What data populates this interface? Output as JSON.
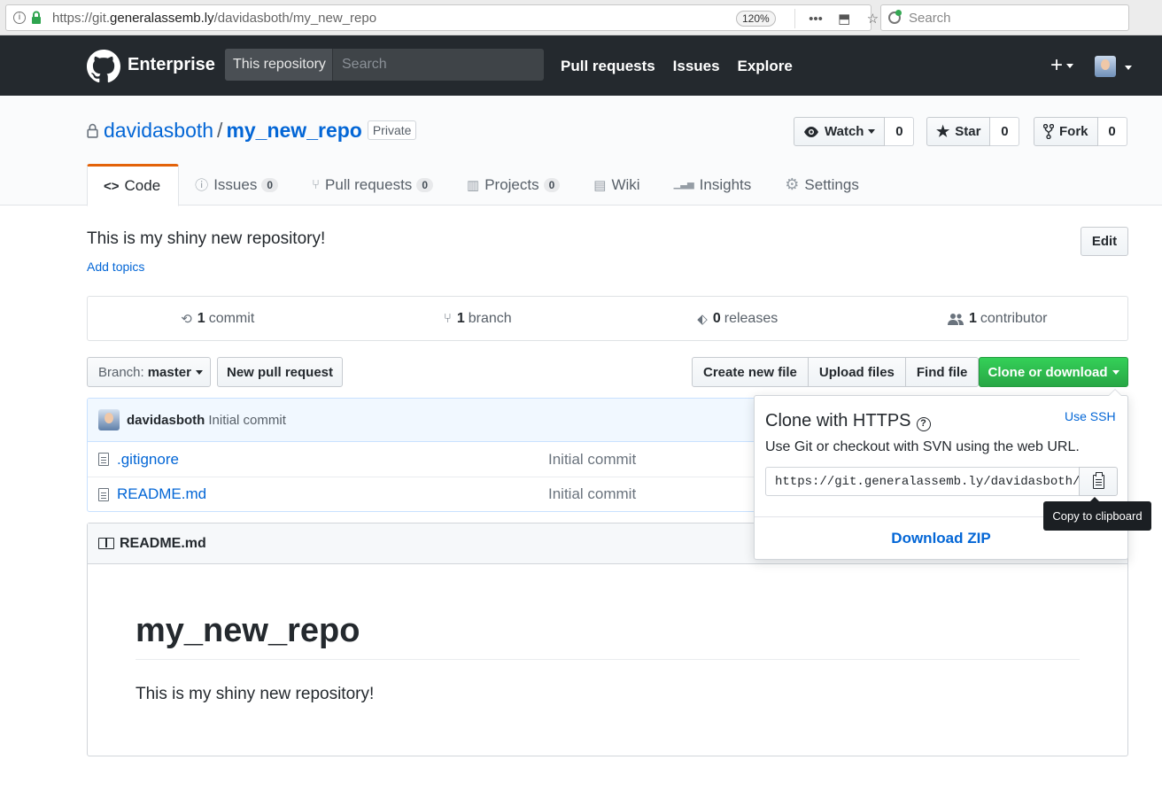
{
  "browser": {
    "url_scheme": "https://git.",
    "url_host": "generalassemb.ly",
    "url_path": "/davidasboth/my_new_repo",
    "zoom": "120%",
    "actions": [
      "•••",
      "⬒",
      "☆"
    ],
    "search_placeholder": "Search"
  },
  "header": {
    "brand": "Enterprise",
    "scope_label": "This repository",
    "search_placeholder": "Search",
    "nav": [
      "Pull requests",
      "Issues",
      "Explore"
    ],
    "plus": "+"
  },
  "repo": {
    "owner": "davidasboth",
    "separator": "/",
    "name": "my_new_repo",
    "visibility": "Private",
    "watch_label": "Watch",
    "watch_count": "0",
    "star_label": "Star",
    "star_count": "0",
    "fork_label": "Fork",
    "fork_count": "0"
  },
  "tabs": [
    {
      "label": "Code",
      "icon": "code-icon",
      "glyph": "<>"
    },
    {
      "label": "Issues",
      "count": "0",
      "icon": "issue-icon",
      "glyph": "ⓘ"
    },
    {
      "label": "Pull requests",
      "count": "0",
      "icon": "pull-request-icon",
      "glyph": "⑂"
    },
    {
      "label": "Projects",
      "count": "0",
      "icon": "project-icon",
      "glyph": "▥"
    },
    {
      "label": "Wiki",
      "icon": "book-icon",
      "glyph": "▤"
    },
    {
      "label": "Insights",
      "icon": "graph-icon",
      "glyph": "▁▃▅"
    },
    {
      "label": "Settings",
      "icon": "gear-icon",
      "glyph": "⚙"
    }
  ],
  "description": "This is my shiny new repository!",
  "add_topics": "Add topics",
  "edit_label": "Edit",
  "summary": {
    "commits_count": "1",
    "commits_label": "commit",
    "branches_count": "1",
    "branches_label": "branch",
    "releases_count": "0",
    "releases_label": "releases",
    "contributors_count": "1",
    "contributors_label": "contributor"
  },
  "toolbar": {
    "branch_prefix": "Branch:",
    "branch_name": "master",
    "new_pr": "New pull request",
    "create_file": "Create new file",
    "upload_files": "Upload files",
    "find_file": "Find file",
    "clone_or_download": "Clone or download"
  },
  "latest_commit": {
    "author": "davidasboth",
    "message": "Initial commit"
  },
  "files": [
    {
      "name": ".gitignore",
      "commit": "Initial commit"
    },
    {
      "name": "README.md",
      "commit": "Initial commit"
    }
  ],
  "readme": {
    "filename": "README.md",
    "heading": "my_new_repo",
    "body": "This is my shiny new repository!"
  },
  "clone": {
    "title": "Clone with HTTPS",
    "help": "?",
    "use_ssh": "Use SSH",
    "subtitle": "Use Git or checkout with SVN using the web URL.",
    "url": "https://git.generalassemb.ly/davidasboth/my_new_repo.git",
    "download_zip": "Download ZIP",
    "tooltip": "Copy to clipboard"
  },
  "colors": {
    "header_bg": "#24292e",
    "link": "#0366d6",
    "clone_button": "#28a745",
    "selected_tab_accent": "#e36209"
  }
}
